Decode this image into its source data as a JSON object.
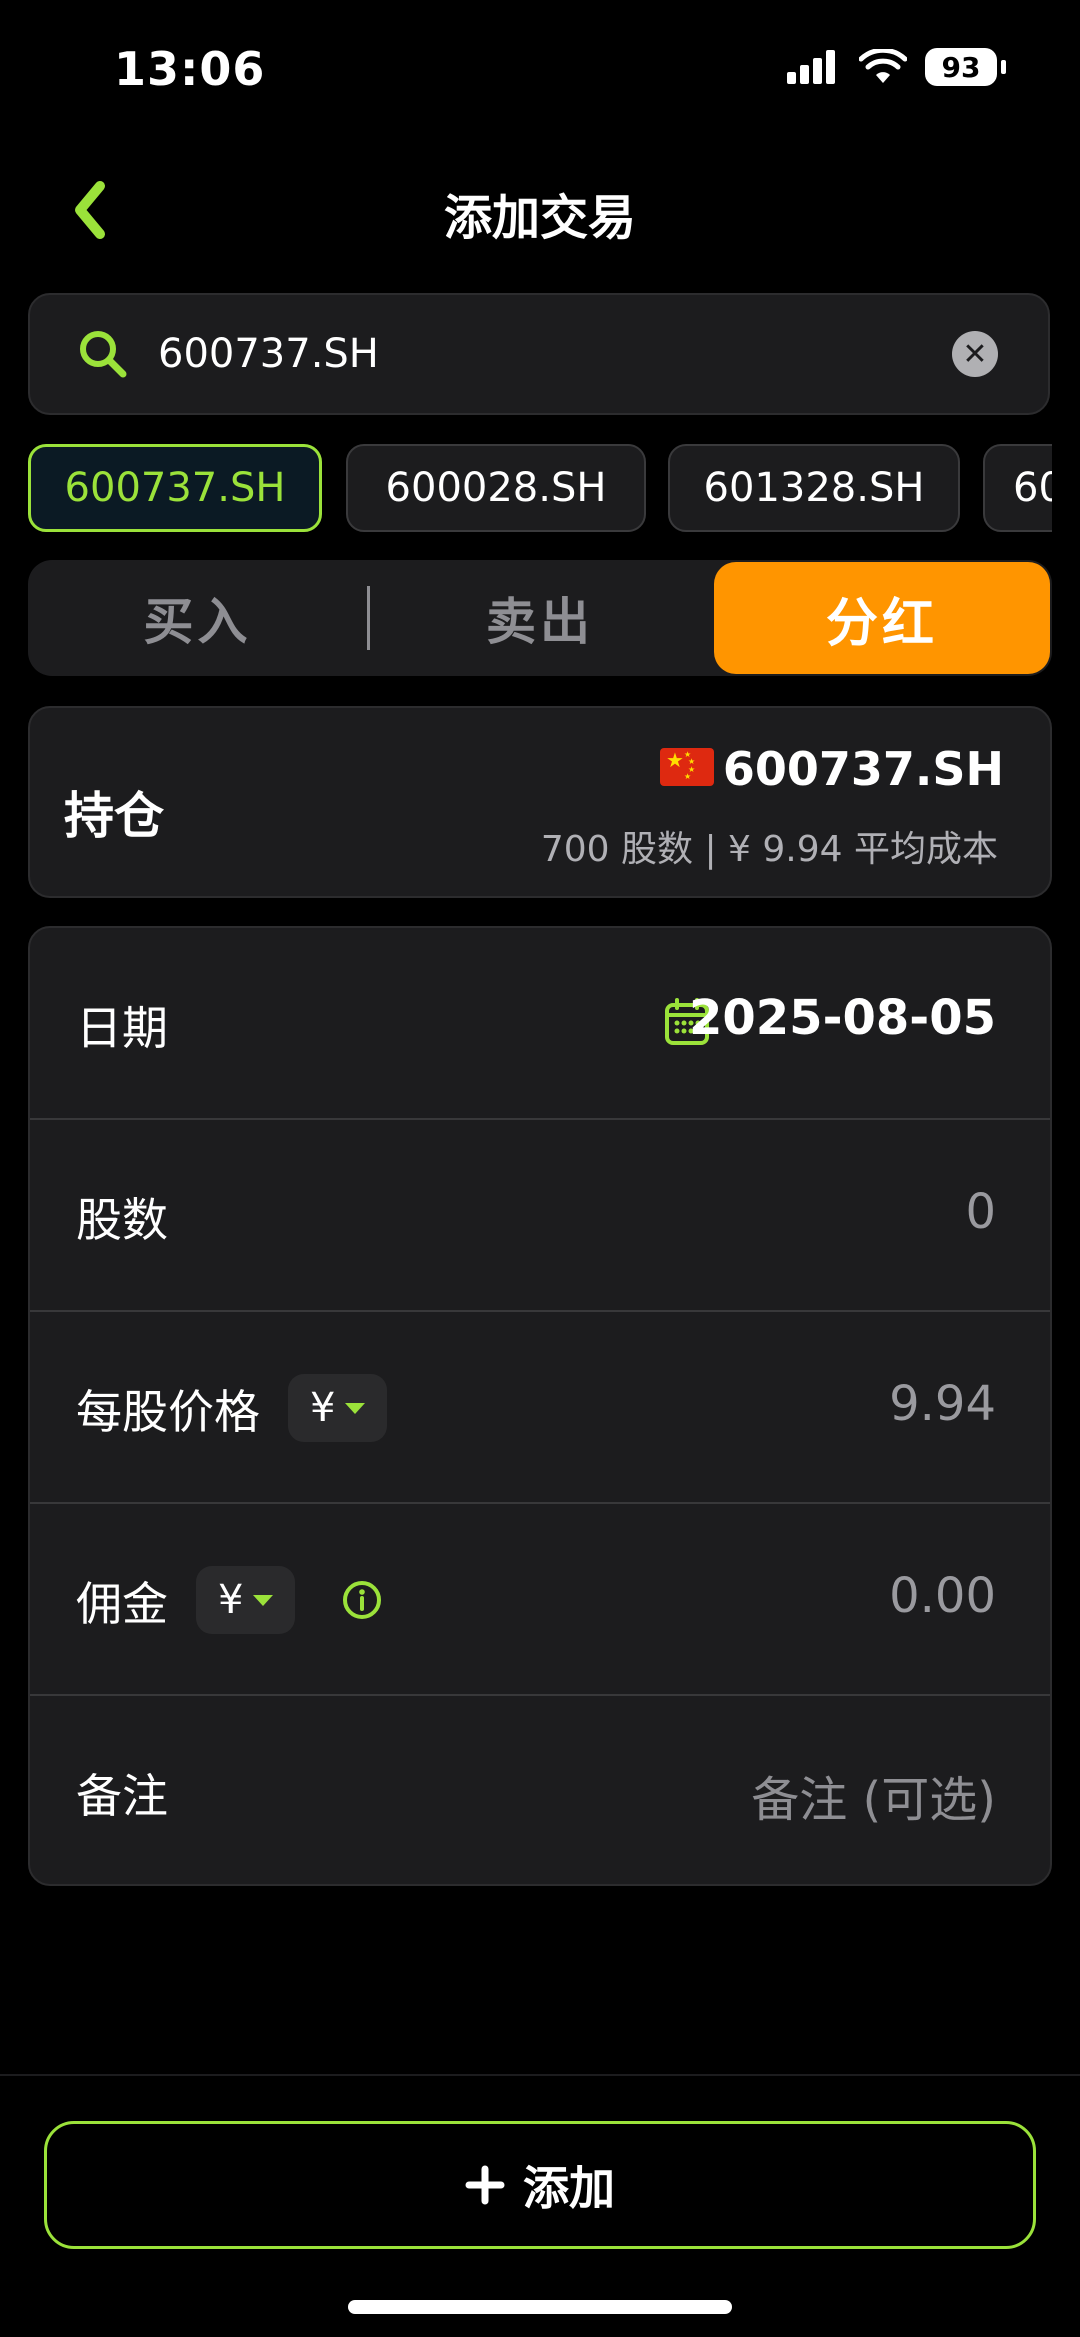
{
  "status_bar": {
    "time": "13:06",
    "battery": "93"
  },
  "nav": {
    "title": "添加交易"
  },
  "search": {
    "value": "600737.SH"
  },
  "chips": [
    "600737.SH",
    "600028.SH",
    "601328.SH",
    "60"
  ],
  "segments": {
    "buy": "买入",
    "sell": "卖出",
    "dividend": "分红",
    "selected": "分红"
  },
  "holding": {
    "label": "持仓",
    "ticker": "600737.SH",
    "detail": "700 股数 | ¥ 9.94 平均成本"
  },
  "form": {
    "date_label": "日期",
    "date_value": "2025-08-05",
    "shares_label": "股数",
    "shares_value": "0",
    "price_label": "每股价格",
    "price_currency": "¥",
    "price_value": "9.94",
    "commission_label": "佣金",
    "commission_currency": "¥",
    "commission_value": "0.00",
    "note_label": "备注",
    "note_placeholder": "备注 (可选)"
  },
  "add_button": {
    "label": "添加"
  },
  "colors": {
    "accent": "#9be23a",
    "dividend": "#ff9500",
    "background": "#000000",
    "card": "#1c1c1e"
  }
}
